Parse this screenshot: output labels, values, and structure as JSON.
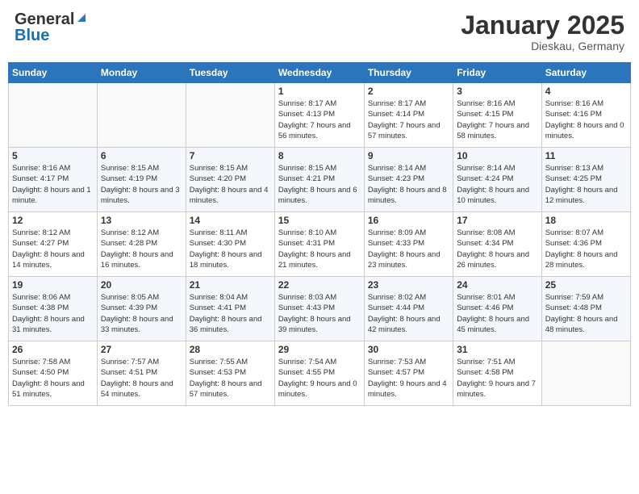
{
  "header": {
    "logo_general": "General",
    "logo_blue": "Blue",
    "month": "January 2025",
    "location": "Dieskau, Germany"
  },
  "weekdays": [
    "Sunday",
    "Monday",
    "Tuesday",
    "Wednesday",
    "Thursday",
    "Friday",
    "Saturday"
  ],
  "weeks": [
    [
      {
        "day": "",
        "info": ""
      },
      {
        "day": "",
        "info": ""
      },
      {
        "day": "",
        "info": ""
      },
      {
        "day": "1",
        "info": "Sunrise: 8:17 AM\nSunset: 4:13 PM\nDaylight: 7 hours and 56 minutes."
      },
      {
        "day": "2",
        "info": "Sunrise: 8:17 AM\nSunset: 4:14 PM\nDaylight: 7 hours and 57 minutes."
      },
      {
        "day": "3",
        "info": "Sunrise: 8:16 AM\nSunset: 4:15 PM\nDaylight: 7 hours and 58 minutes."
      },
      {
        "day": "4",
        "info": "Sunrise: 8:16 AM\nSunset: 4:16 PM\nDaylight: 8 hours and 0 minutes."
      }
    ],
    [
      {
        "day": "5",
        "info": "Sunrise: 8:16 AM\nSunset: 4:17 PM\nDaylight: 8 hours and 1 minute."
      },
      {
        "day": "6",
        "info": "Sunrise: 8:15 AM\nSunset: 4:19 PM\nDaylight: 8 hours and 3 minutes."
      },
      {
        "day": "7",
        "info": "Sunrise: 8:15 AM\nSunset: 4:20 PM\nDaylight: 8 hours and 4 minutes."
      },
      {
        "day": "8",
        "info": "Sunrise: 8:15 AM\nSunset: 4:21 PM\nDaylight: 8 hours and 6 minutes."
      },
      {
        "day": "9",
        "info": "Sunrise: 8:14 AM\nSunset: 4:23 PM\nDaylight: 8 hours and 8 minutes."
      },
      {
        "day": "10",
        "info": "Sunrise: 8:14 AM\nSunset: 4:24 PM\nDaylight: 8 hours and 10 minutes."
      },
      {
        "day": "11",
        "info": "Sunrise: 8:13 AM\nSunset: 4:25 PM\nDaylight: 8 hours and 12 minutes."
      }
    ],
    [
      {
        "day": "12",
        "info": "Sunrise: 8:12 AM\nSunset: 4:27 PM\nDaylight: 8 hours and 14 minutes."
      },
      {
        "day": "13",
        "info": "Sunrise: 8:12 AM\nSunset: 4:28 PM\nDaylight: 8 hours and 16 minutes."
      },
      {
        "day": "14",
        "info": "Sunrise: 8:11 AM\nSunset: 4:30 PM\nDaylight: 8 hours and 18 minutes."
      },
      {
        "day": "15",
        "info": "Sunrise: 8:10 AM\nSunset: 4:31 PM\nDaylight: 8 hours and 21 minutes."
      },
      {
        "day": "16",
        "info": "Sunrise: 8:09 AM\nSunset: 4:33 PM\nDaylight: 8 hours and 23 minutes."
      },
      {
        "day": "17",
        "info": "Sunrise: 8:08 AM\nSunset: 4:34 PM\nDaylight: 8 hours and 26 minutes."
      },
      {
        "day": "18",
        "info": "Sunrise: 8:07 AM\nSunset: 4:36 PM\nDaylight: 8 hours and 28 minutes."
      }
    ],
    [
      {
        "day": "19",
        "info": "Sunrise: 8:06 AM\nSunset: 4:38 PM\nDaylight: 8 hours and 31 minutes."
      },
      {
        "day": "20",
        "info": "Sunrise: 8:05 AM\nSunset: 4:39 PM\nDaylight: 8 hours and 33 minutes."
      },
      {
        "day": "21",
        "info": "Sunrise: 8:04 AM\nSunset: 4:41 PM\nDaylight: 8 hours and 36 minutes."
      },
      {
        "day": "22",
        "info": "Sunrise: 8:03 AM\nSunset: 4:43 PM\nDaylight: 8 hours and 39 minutes."
      },
      {
        "day": "23",
        "info": "Sunrise: 8:02 AM\nSunset: 4:44 PM\nDaylight: 8 hours and 42 minutes."
      },
      {
        "day": "24",
        "info": "Sunrise: 8:01 AM\nSunset: 4:46 PM\nDaylight: 8 hours and 45 minutes."
      },
      {
        "day": "25",
        "info": "Sunrise: 7:59 AM\nSunset: 4:48 PM\nDaylight: 8 hours and 48 minutes."
      }
    ],
    [
      {
        "day": "26",
        "info": "Sunrise: 7:58 AM\nSunset: 4:50 PM\nDaylight: 8 hours and 51 minutes."
      },
      {
        "day": "27",
        "info": "Sunrise: 7:57 AM\nSunset: 4:51 PM\nDaylight: 8 hours and 54 minutes."
      },
      {
        "day": "28",
        "info": "Sunrise: 7:55 AM\nSunset: 4:53 PM\nDaylight: 8 hours and 57 minutes."
      },
      {
        "day": "29",
        "info": "Sunrise: 7:54 AM\nSunset: 4:55 PM\nDaylight: 9 hours and 0 minutes."
      },
      {
        "day": "30",
        "info": "Sunrise: 7:53 AM\nSunset: 4:57 PM\nDaylight: 9 hours and 4 minutes."
      },
      {
        "day": "31",
        "info": "Sunrise: 7:51 AM\nSunset: 4:58 PM\nDaylight: 9 hours and 7 minutes."
      },
      {
        "day": "",
        "info": ""
      }
    ]
  ]
}
